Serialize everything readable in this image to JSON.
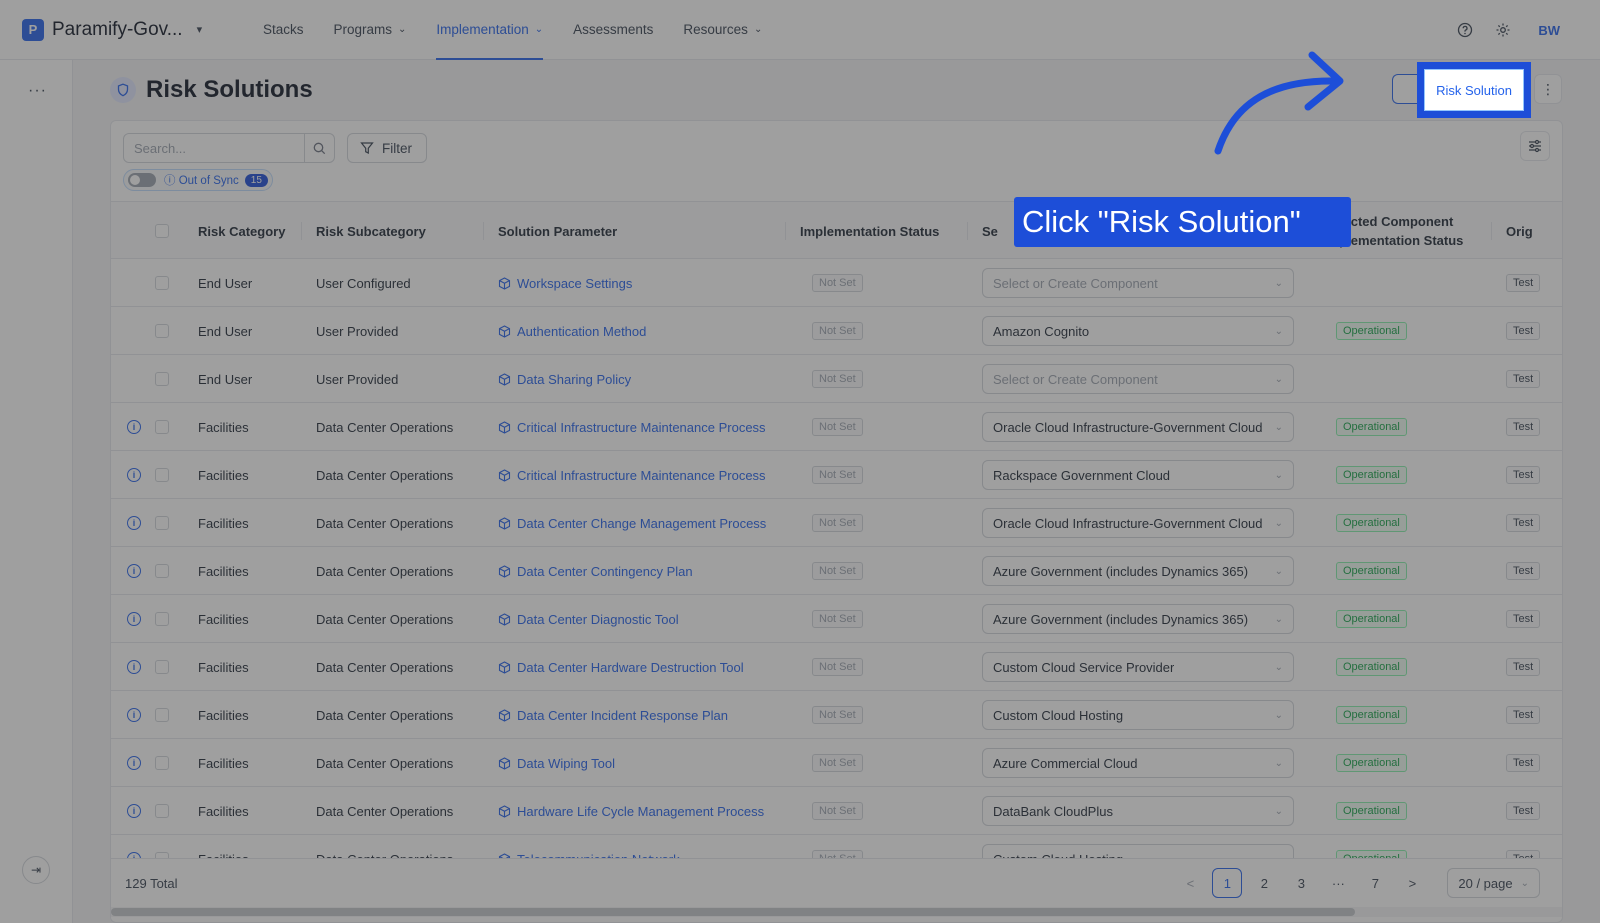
{
  "app": {
    "org_name": "Paramify-Gov...",
    "logo_glyph": "P"
  },
  "nav": {
    "items": [
      {
        "label": "Stacks",
        "has_menu": false,
        "active": false
      },
      {
        "label": "Programs",
        "has_menu": true,
        "active": false
      },
      {
        "label": "Implementation",
        "has_menu": true,
        "active": true
      },
      {
        "label": "Assessments",
        "has_menu": false,
        "active": false
      },
      {
        "label": "Resources",
        "has_menu": true,
        "active": false
      }
    ],
    "avatar_initials": "BW"
  },
  "rail": {
    "menu_glyph": "···",
    "collapse_glyph": "⇥"
  },
  "page": {
    "title": "Risk Solutions",
    "primary_action": "Risk Solution",
    "more_glyph": "⋮"
  },
  "toolbar": {
    "search_placeholder": "Search...",
    "filter_label": "Filter",
    "sync_label": "Out of Sync",
    "sync_count": "15"
  },
  "table": {
    "columns": [
      "Risk Category",
      "Risk Subcategory",
      "Solution Parameter",
      "Implementation Status",
      "Se",
      "Selected Component Implementation Status",
      "Orig"
    ],
    "rows": [
      {
        "info": false,
        "category": "End User",
        "subcategory": "User Configured",
        "parameter": "Workspace Settings",
        "status": "Not Set",
        "component": "Select or Create Component",
        "placeholder": true,
        "comp_status": "",
        "orig": "Test"
      },
      {
        "info": false,
        "category": "End User",
        "subcategory": "User Provided",
        "parameter": "Authentication Method",
        "status": "Not Set",
        "component": "Amazon Cognito",
        "placeholder": false,
        "comp_status": "Operational",
        "orig": "Test"
      },
      {
        "info": false,
        "category": "End User",
        "subcategory": "User Provided",
        "parameter": "Data Sharing Policy",
        "status": "Not Set",
        "component": "Select or Create Component",
        "placeholder": true,
        "comp_status": "",
        "orig": "Test"
      },
      {
        "info": true,
        "category": "Facilities",
        "subcategory": "Data Center Operations",
        "parameter": "Critical Infrastructure Maintenance Process",
        "status": "Not Set",
        "component": "Oracle Cloud Infrastructure-Government Cloud",
        "placeholder": false,
        "comp_status": "Operational",
        "orig": "Test"
      },
      {
        "info": true,
        "category": "Facilities",
        "subcategory": "Data Center Operations",
        "parameter": "Critical Infrastructure Maintenance Process",
        "status": "Not Set",
        "component": "Rackspace Government Cloud",
        "placeholder": false,
        "comp_status": "Operational",
        "orig": "Test"
      },
      {
        "info": true,
        "category": "Facilities",
        "subcategory": "Data Center Operations",
        "parameter": "Data Center Change Management Process",
        "status": "Not Set",
        "component": "Oracle Cloud Infrastructure-Government Cloud",
        "placeholder": false,
        "comp_status": "Operational",
        "orig": "Test"
      },
      {
        "info": true,
        "category": "Facilities",
        "subcategory": "Data Center Operations",
        "parameter": "Data Center Contingency Plan",
        "status": "Not Set",
        "component": "Azure Government (includes Dynamics 365)",
        "placeholder": false,
        "comp_status": "Operational",
        "orig": "Test"
      },
      {
        "info": true,
        "category": "Facilities",
        "subcategory": "Data Center Operations",
        "parameter": "Data Center Diagnostic Tool",
        "status": "Not Set",
        "component": "Azure Government (includes Dynamics 365)",
        "placeholder": false,
        "comp_status": "Operational",
        "orig": "Test"
      },
      {
        "info": true,
        "category": "Facilities",
        "subcategory": "Data Center Operations",
        "parameter": "Data Center Hardware Destruction Tool",
        "status": "Not Set",
        "component": "Custom Cloud Service Provider",
        "placeholder": false,
        "comp_status": "Operational",
        "orig": "Test"
      },
      {
        "info": true,
        "category": "Facilities",
        "subcategory": "Data Center Operations",
        "parameter": "Data Center Incident Response Plan",
        "status": "Not Set",
        "component": "Custom Cloud Hosting",
        "placeholder": false,
        "comp_status": "Operational",
        "orig": "Test"
      },
      {
        "info": true,
        "category": "Facilities",
        "subcategory": "Data Center Operations",
        "parameter": "Data Wiping Tool",
        "status": "Not Set",
        "component": "Azure Commercial Cloud",
        "placeholder": false,
        "comp_status": "Operational",
        "orig": "Test"
      },
      {
        "info": true,
        "category": "Facilities",
        "subcategory": "Data Center Operations",
        "parameter": "Hardware Life Cycle Management Process",
        "status": "Not Set",
        "component": "DataBank CloudPlus",
        "placeholder": false,
        "comp_status": "Operational",
        "orig": "Test"
      },
      {
        "info": true,
        "category": "Facilities",
        "subcategory": "Data Center Operations",
        "parameter": "Telecommunication Network",
        "status": "Not Set",
        "component": "Custom Cloud Hosting",
        "placeholder": false,
        "comp_status": "Operational",
        "orig": "Test"
      }
    ]
  },
  "footer": {
    "total": "129 Total",
    "pages": [
      "1",
      "2",
      "3",
      "···",
      "7"
    ],
    "current_page": "1",
    "prev_glyph": "<",
    "next_glyph": ">",
    "page_size": "20 / page"
  },
  "tutorial": {
    "callout": "Click \"Risk Solution\"",
    "accent_color": "#1d4ed8"
  },
  "colors": {
    "primary": "#2563eb",
    "success": "#16a34a"
  }
}
